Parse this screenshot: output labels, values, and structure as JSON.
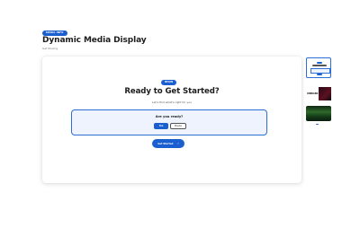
{
  "header": {
    "badge": "Media Info",
    "title": "Dynamic Media Display",
    "subtitle": "Get Moving"
  },
  "card": {
    "badge": "Begin",
    "title": "Ready to Get Started?",
    "subtitle": "Let's find what's right for you",
    "question": {
      "label": "Are you ready?",
      "choices": [
        "Yes",
        "Maybe"
      ],
      "selected": "Yes"
    },
    "cta": {
      "label": "Get Started",
      "icon": "chevron-right-icon"
    }
  },
  "thumbnails": {
    "items": [
      {
        "name": "thumb-question-slide"
      },
      {
        "name": "thumb-dark-media",
        "text": "ONBOARD"
      },
      {
        "name": "thumb-text-slide"
      },
      {
        "name": "thumb-nature-media"
      }
    ],
    "active_index": 0
  },
  "colors": {
    "accent": "#1a5fd0",
    "background": "#ffffff",
    "question_bg": "#eef3fd"
  }
}
